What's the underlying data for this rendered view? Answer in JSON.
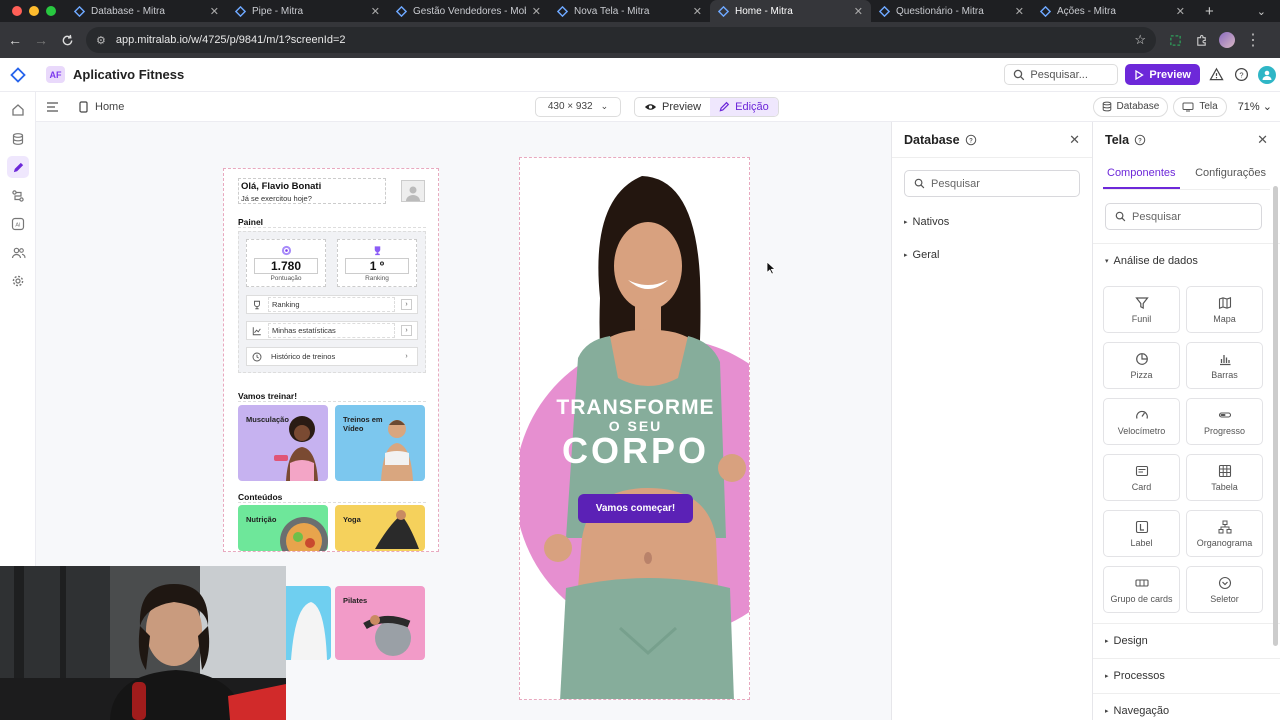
{
  "browser": {
    "tabs": [
      {
        "title": "Database - Mitra",
        "active": false
      },
      {
        "title": "Pipe - Mitra",
        "active": false
      },
      {
        "title": "Gestão Vendedores - Mobi",
        "active": false
      },
      {
        "title": "Nova Tela - Mitra",
        "active": false
      },
      {
        "title": "Home - Mitra",
        "active": true
      },
      {
        "title": "Questionário - Mitra",
        "active": false
      },
      {
        "title": "Ações - Mitra",
        "active": false
      }
    ],
    "url": "app.mitralab.io/w/4725/p/9841/m/1?screenId=2"
  },
  "app": {
    "badge": "AF",
    "name": "Aplicativo Fitness",
    "search_placeholder": "Pesquisar...",
    "preview_label": "Preview",
    "accent": "#6d28d9"
  },
  "toolbar": {
    "page": "Home",
    "device_size": "430 × 932",
    "mode_preview": "Preview",
    "mode_edit": "Edição",
    "database_chip": "Database",
    "tela_chip": "Tela",
    "zoom": "71%"
  },
  "screen1": {
    "greeting": "Olá,  Flavio Bonati",
    "subgreeting": "Já se exercitou hoje?",
    "painel_title": "Painel",
    "stats": [
      {
        "value": "1.780",
        "label": "Pontuação"
      },
      {
        "value": "1 º",
        "label": "Ranking"
      }
    ],
    "menu": [
      {
        "label": "Ranking",
        "icon": "trophy-icon"
      },
      {
        "label": "Minhas estatísticas",
        "icon": "chart-icon"
      },
      {
        "label": "Histórico de treinos",
        "icon": "clock-icon"
      }
    ],
    "train_title": "Vamos treinar!",
    "train_cards": [
      {
        "label": "Musculação",
        "color": "#c6b2f0"
      },
      {
        "label": "Treinos em Vídeo",
        "color": "#7cc7ee"
      }
    ],
    "content_title": "Conteúdos",
    "content_cards": [
      {
        "label": "Nutrição",
        "color": "#6ee79a"
      },
      {
        "label": "Yoga",
        "color": "#f5d15c"
      },
      {
        "label": "",
        "color": "#6fcff0"
      },
      {
        "label": "Pilates",
        "color": "#f29bc8"
      }
    ]
  },
  "screen2": {
    "line1": "TRANSFORME",
    "line2": "O SEU",
    "line3": "CORPO",
    "cta": "Vamos começar!"
  },
  "database_panel": {
    "title": "Database",
    "search_placeholder": "Pesquisar",
    "items": [
      "Nativos",
      "Geral"
    ]
  },
  "tela_panel": {
    "title": "Tela",
    "tab_components": "Componentes",
    "tab_settings": "Configurações",
    "search_placeholder": "Pesquisar",
    "section_analysis": "Análise de dados",
    "components": [
      {
        "label": "Funil",
        "icon": "funnel-icon"
      },
      {
        "label": "Mapa",
        "icon": "map-icon"
      },
      {
        "label": "Pizza",
        "icon": "pie-icon"
      },
      {
        "label": "Barras",
        "icon": "bars-icon"
      },
      {
        "label": "Velocímetro",
        "icon": "gauge-icon"
      },
      {
        "label": "Progresso",
        "icon": "progress-icon"
      },
      {
        "label": "Card",
        "icon": "card-icon"
      },
      {
        "label": "Tabela",
        "icon": "table-icon"
      },
      {
        "label": "Label",
        "icon": "label-icon"
      },
      {
        "label": "Organograma",
        "icon": "org-icon"
      },
      {
        "label": "Grupo de cards",
        "icon": "cards-group-icon"
      },
      {
        "label": "Seletor",
        "icon": "selector-icon"
      }
    ],
    "section_design": "Design",
    "section_processes": "Processos",
    "section_navigation": "Navegação"
  }
}
